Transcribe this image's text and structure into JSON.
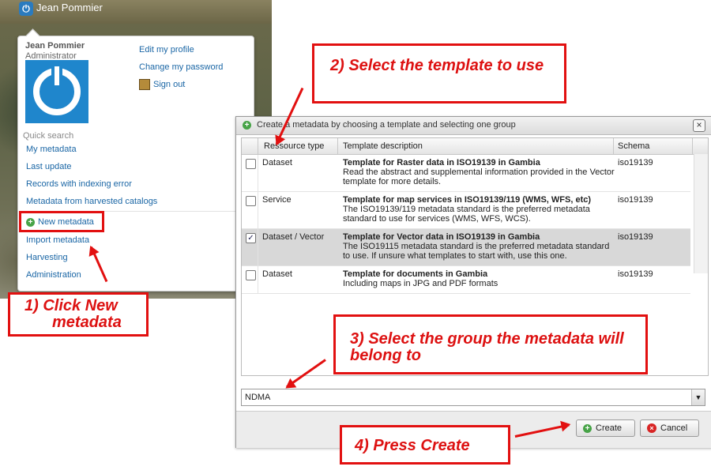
{
  "topbar": {
    "user": "Jean Pommier"
  },
  "popup": {
    "name": "Jean Pommier",
    "role": "Administrator",
    "links": {
      "edit_profile": "Edit my profile",
      "change_password": "Change my password",
      "sign_out": "Sign out"
    },
    "quick_search_label": "Quick search",
    "quick_links": [
      "My metadata",
      "Last update",
      "Records with indexing error",
      "Metadata from harvested catalogs"
    ],
    "new_metadata": "New metadata",
    "admin_links": [
      "Import metadata",
      "Harvesting",
      "Administration"
    ]
  },
  "annotations": {
    "step1_line1": "1) Click New",
    "step1_line2": "metadata",
    "step2": "2) Select the template to use",
    "step3": "3) Select the group the metadata will belong to",
    "step4": "4) Press Create"
  },
  "dialog": {
    "title": "Create a metadata by choosing a template and selecting one group",
    "columns": [
      "Ressource type",
      "Template description",
      "Schema"
    ],
    "rows": [
      {
        "type": "Dataset",
        "title": "Template for Raster data in ISO19139 in Gambia",
        "desc": "Read the abstract and supplemental information provided in the Vector template for more details.",
        "schema": "iso19139",
        "checked": false
      },
      {
        "type": "Service",
        "title": "Template for map services in ISO19139/119 (WMS, WFS, etc)",
        "desc": "The ISO19139/119 metadata standard is the preferred metadata standard to use for services (WMS, WFS, WCS).",
        "schema": "iso19139",
        "checked": false
      },
      {
        "type": "Dataset / Vector",
        "title": "Template for Vector data in ISO19139 in Gambia",
        "desc": "The ISO19115 metadata standard is the preferred metadata standard to use. If unsure what templates to start with, use this one.",
        "schema": "iso19139",
        "checked": true
      },
      {
        "type": "Dataset",
        "title": "Template for documents in Gambia",
        "desc": "Including maps in JPG and PDF formats",
        "schema": "iso19139",
        "checked": false
      }
    ],
    "group_value": "NDMA",
    "buttons": {
      "create": "Create",
      "cancel": "Cancel"
    }
  }
}
